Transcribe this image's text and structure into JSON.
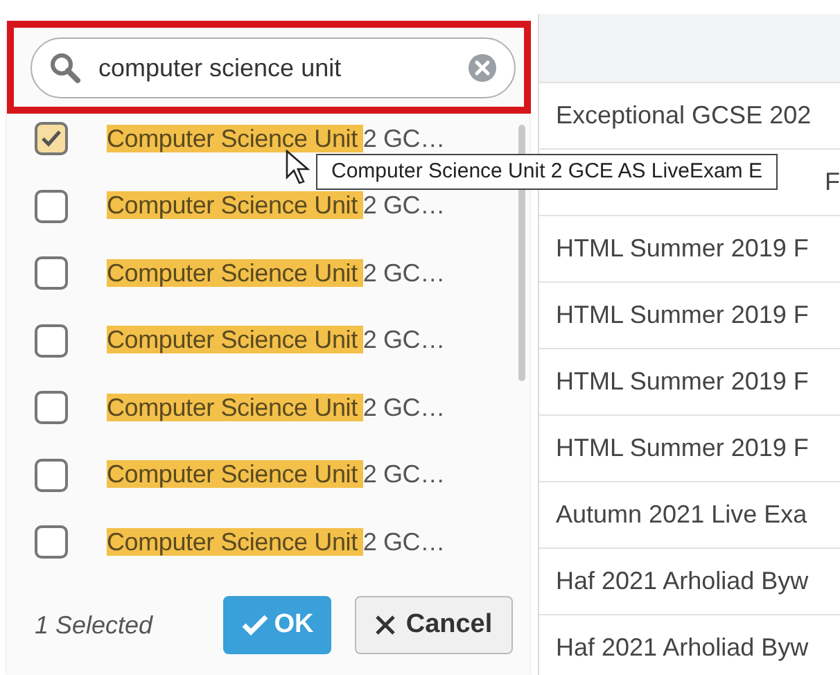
{
  "search": {
    "value": "computer science unit"
  },
  "options": [
    {
      "match": "Computer Science Unit",
      "rest": "2 GC…",
      "checked": true
    },
    {
      "match": "Computer Science Unit",
      "rest": "2 GC…",
      "checked": false
    },
    {
      "match": "Computer Science Unit",
      "rest": "2 GC…",
      "checked": false
    },
    {
      "match": "Computer Science Unit",
      "rest": "2 GC…",
      "checked": false
    },
    {
      "match": "Computer Science Unit",
      "rest": "2 GC…",
      "checked": false
    },
    {
      "match": "Computer Science Unit",
      "rest": "2 GC…",
      "checked": false
    },
    {
      "match": "Computer Science Unit",
      "rest": "2 GC…",
      "checked": false
    }
  ],
  "tooltip": "Computer Science Unit 2 GCE AS LiveExam E",
  "selected_count": "1 Selected",
  "buttons": [
    {
      "kind": "ok",
      "label": "OK"
    },
    {
      "kind": "cancel",
      "label": "Cancel"
    }
  ],
  "table": {
    "rows": [
      "Exceptional GCSE 202",
      "F",
      "HTML Summer 2019 F",
      "HTML Summer 2019 F",
      "HTML Summer 2019 F",
      "HTML Summer 2019 F",
      "Autumn 2021 Live Exa",
      "Haf 2021 Arholiad Byw",
      "Haf 2021 Arholiad Byw"
    ]
  }
}
